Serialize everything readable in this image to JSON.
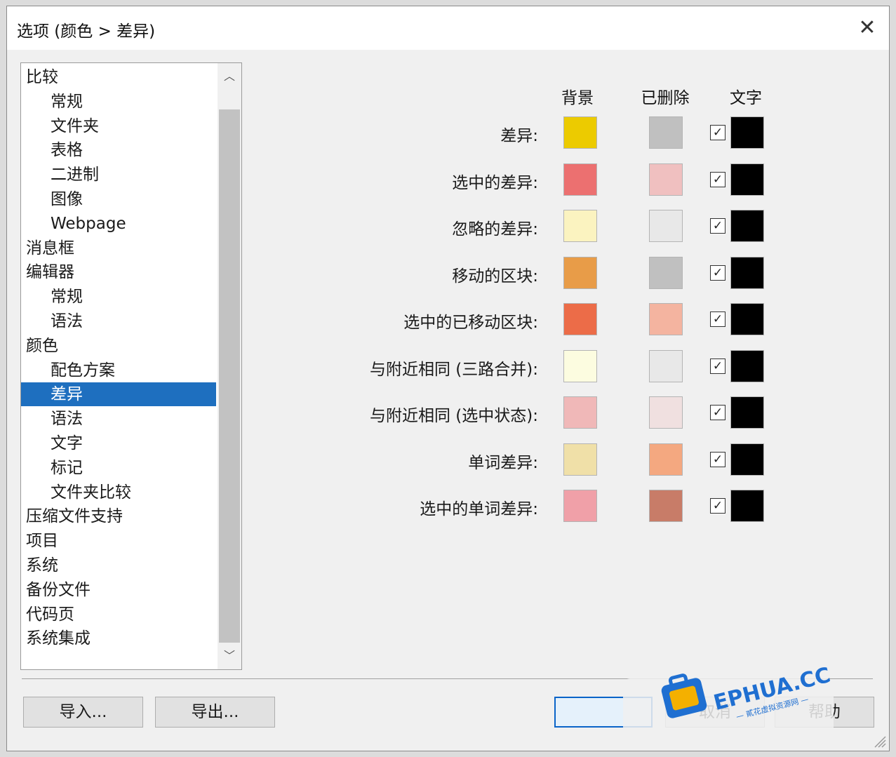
{
  "window": {
    "title": "选项 (颜色 > 差异)"
  },
  "tree": {
    "items": [
      {
        "label": "比较",
        "level": 0
      },
      {
        "label": "常规",
        "level": 1
      },
      {
        "label": "文件夹",
        "level": 1
      },
      {
        "label": "表格",
        "level": 1
      },
      {
        "label": "二进制",
        "level": 1
      },
      {
        "label": "图像",
        "level": 1
      },
      {
        "label": "Webpage",
        "level": 1
      },
      {
        "label": "消息框",
        "level": 0
      },
      {
        "label": "编辑器",
        "level": 0
      },
      {
        "label": "常规",
        "level": 1
      },
      {
        "label": "语法",
        "level": 1
      },
      {
        "label": "颜色",
        "level": 0
      },
      {
        "label": "配色方案",
        "level": 1
      },
      {
        "label": "差异",
        "level": 1,
        "selected": true
      },
      {
        "label": "语法",
        "level": 1
      },
      {
        "label": "文字",
        "level": 1
      },
      {
        "label": "标记",
        "level": 1
      },
      {
        "label": "文件夹比较",
        "level": 1
      },
      {
        "label": "压缩文件支持",
        "level": 0
      },
      {
        "label": "项目",
        "level": 0
      },
      {
        "label": "系统",
        "level": 0
      },
      {
        "label": "备份文件",
        "level": 0
      },
      {
        "label": "代码页",
        "level": 0
      },
      {
        "label": "系统集成",
        "level": 0
      }
    ]
  },
  "columns": {
    "background": "背景",
    "deleted": "已删除",
    "text": "文字"
  },
  "rows": [
    {
      "label": "差异:",
      "bg": "#eccb00",
      "deleted": "#c0c0c0",
      "text_checked": true,
      "text_color": "#000000"
    },
    {
      "label": "选中的差异:",
      "bg": "#ec7070",
      "deleted": "#f0c0c0",
      "text_checked": true,
      "text_color": "#000000"
    },
    {
      "label": "忽略的差异:",
      "bg": "#fbf3c0",
      "deleted": "#e8e8e8",
      "text_checked": true,
      "text_color": "#000000"
    },
    {
      "label": "移动的区块:",
      "bg": "#e89c48",
      "deleted": "#c0c0c0",
      "text_checked": true,
      "text_color": "#000000"
    },
    {
      "label": "选中的已移动区块:",
      "bg": "#ec6c48",
      "deleted": "#f4b4a0",
      "text_checked": true,
      "text_color": "#000000"
    },
    {
      "label": "与附近相同 (三路合并):",
      "bg": "#fcfce0",
      "deleted": "#e8e8e8",
      "text_checked": true,
      "text_color": "#000000"
    },
    {
      "label": "与附近相同 (选中状态):",
      "bg": "#f0b8b8",
      "deleted": "#f0e0e0",
      "text_checked": true,
      "text_color": "#000000"
    },
    {
      "label": "单词差异:",
      "bg": "#f0e0a8",
      "deleted": "#f4a880",
      "text_checked": true,
      "text_color": "#000000"
    },
    {
      "label": "选中的单词差异:",
      "bg": "#f0a0a8",
      "deleted": "#c87c68",
      "text_checked": true,
      "text_color": "#000000"
    }
  ],
  "buttons": {
    "import": "导入...",
    "export": "导出...",
    "ok": "",
    "cancel": "取消",
    "help": "帮助"
  },
  "icons": {
    "close": "close-icon",
    "scroll_up": "chevron-up-icon",
    "scroll_down": "chevron-down-icon",
    "check": "checkmark-icon"
  },
  "watermark": {
    "brand": "EPHUA.CC",
    "tagline": "貳花虚拟资源网"
  }
}
